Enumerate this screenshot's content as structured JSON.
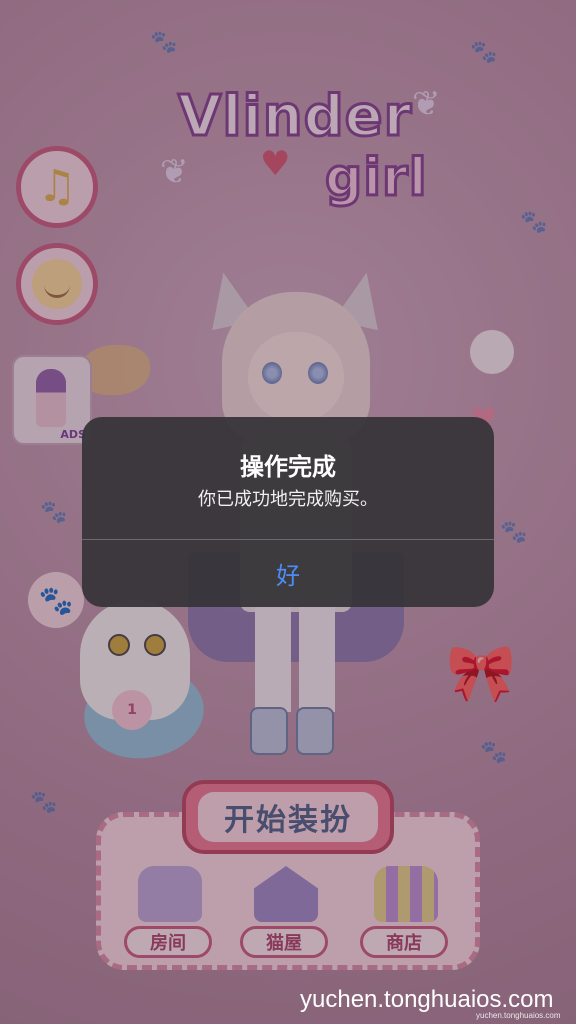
{
  "game": {
    "logo_top": "Vlinder",
    "logo_bottom": "girl",
    "promo_tag": "ADS",
    "cat_level": "1",
    "start_label": "开始装扮",
    "menu": [
      {
        "label": "房间"
      },
      {
        "label": "猫屋"
      },
      {
        "label": "商店"
      }
    ]
  },
  "alert": {
    "title": "操作完成",
    "message": "你已成功地完成购买。",
    "ok_label": "好"
  },
  "watermark": {
    "text": "yuchen.tonghuaios.com",
    "small_text": "yuchen.tonghuaios.com"
  },
  "colors": {
    "accent_blue": "#4c8df3",
    "alert_bg": "#363438",
    "panel_pink": "#f3d7e1"
  }
}
